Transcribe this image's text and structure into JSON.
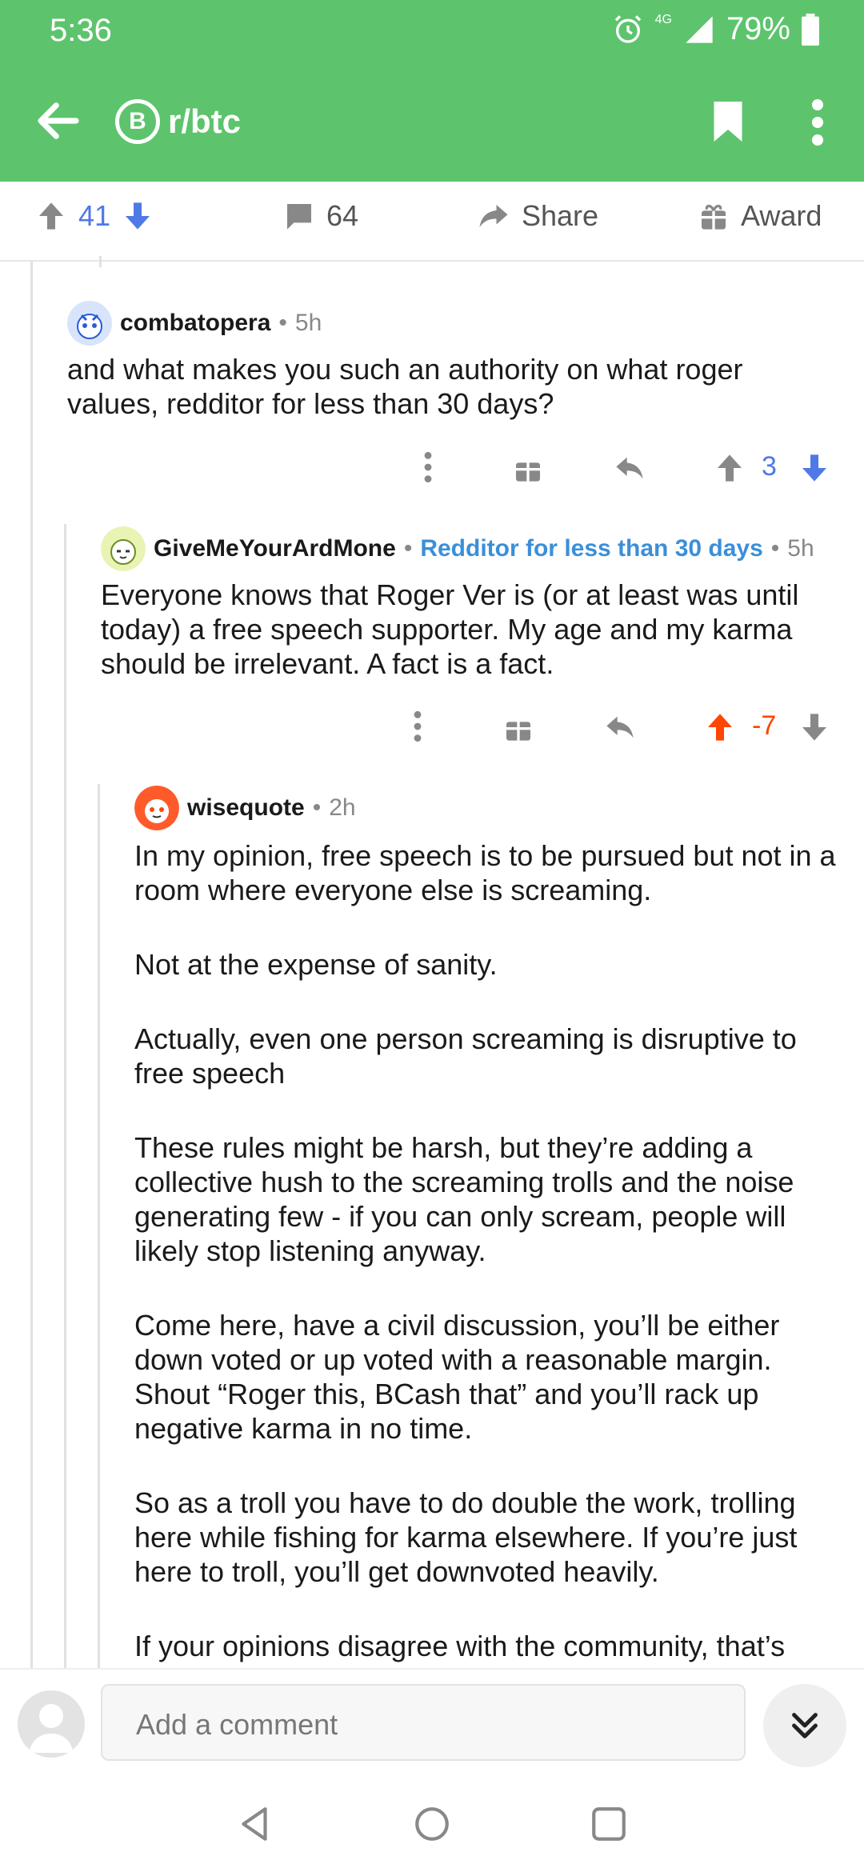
{
  "status": {
    "time": "5:36",
    "network": "4G",
    "battery": "79%"
  },
  "appbar": {
    "subreddit": "r/btc",
    "sub_icon": "B"
  },
  "post_actions": {
    "score": "41",
    "comments": "64",
    "share": "Share",
    "award": "Award"
  },
  "comments": [
    {
      "user": "combatopera",
      "age": "5h",
      "body": [
        "and what makes you such an authority on what roger values, redditor for less than 30 days?"
      ],
      "score": "3",
      "vote": "none"
    },
    {
      "user": "GiveMeYourArdMone",
      "flair": "Redditor for less than 30 days",
      "age": "5h",
      "body": [
        "Everyone knows that Roger Ver is (or at least was until today) a free speech supporter. My age and my karma should be irrelevant. A fact is a fact."
      ],
      "score": "-7",
      "vote": "up"
    },
    {
      "user": "wisequote",
      "age": "2h",
      "body": [
        "In my opinion, free speech is to be pursued but not in a room where everyone else is screaming.",
        "Not at the expense of sanity.",
        "Actually, even one person screaming is disruptive to free speech",
        "These rules might be harsh, but they’re adding a collective hush to the screaming trolls and the noise generating few - if you can only scream, people will likely stop listening anyway.",
        "Come here, have a civil discussion, you’ll be either down voted or up voted with a reasonable margin. Shout “Roger this, BCash that” and you’ll rack up negative karma in no time.",
        "So as a troll you have to do double the work, trolling here while fishing for karma elsewhere. If you’re just here to troll, you’ll get downvoted heavily.",
        "If your opinions disagree with the community, that’s"
      ]
    }
  ],
  "input": {
    "placeholder": "Add a comment"
  },
  "colors": {
    "brand_green": "#5dc46d",
    "upvote_orange": "#ff4500",
    "downvote_blue": "#4f79e6",
    "flair_blue": "#3b8fd9"
  },
  "icons": [
    "back-arrow-icon",
    "bitcoin-icon",
    "bookmark-icon",
    "more-vertical-icon",
    "upvote-icon",
    "downvote-icon",
    "comment-icon",
    "share-icon",
    "gift-icon",
    "reply-icon",
    "chevron-double-down-icon"
  ]
}
